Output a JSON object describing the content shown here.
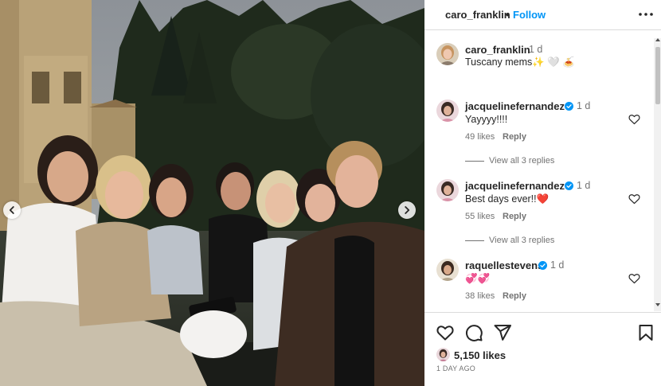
{
  "post": {
    "author": "caro_franklin",
    "separator": "•",
    "follow_label": "Follow",
    "caption_author": "caro_franklin",
    "caption_time": "1 d",
    "caption_text": "Tuscany mems✨ 🤍 🍝"
  },
  "comments": [
    {
      "username": "jacquelinefernandez",
      "verified": true,
      "time": "1 d",
      "text": "Yayyyy!!!!",
      "likes": "49 likes",
      "reply_label": "Reply",
      "view_replies": "View all 3 replies"
    },
    {
      "username": "jacquelinefernandez",
      "verified": true,
      "time": "1 d",
      "text": "Best days ever!!❤️",
      "likes": "55 likes",
      "reply_label": "Reply",
      "view_replies": "View all 3 replies"
    },
    {
      "username": "raquellestevens",
      "verified": true,
      "time": "1 d",
      "text": "💞💞",
      "likes": "38 likes",
      "reply_label": "Reply"
    }
  ],
  "footer": {
    "like_count": "5,150 likes",
    "date": "1 DAY AGO"
  },
  "icons": {
    "prev": "chevron-left-icon",
    "next": "chevron-right-icon",
    "more": "more-options-icon",
    "like": "heart-icon",
    "comment": "comment-icon",
    "share": "share-icon",
    "save": "bookmark-icon"
  },
  "colors": {
    "link_blue": "#0095f6",
    "verified_blue": "#0095f6",
    "text_primary": "#262626",
    "text_secondary": "#737373",
    "divider": "#dbdbdb"
  }
}
